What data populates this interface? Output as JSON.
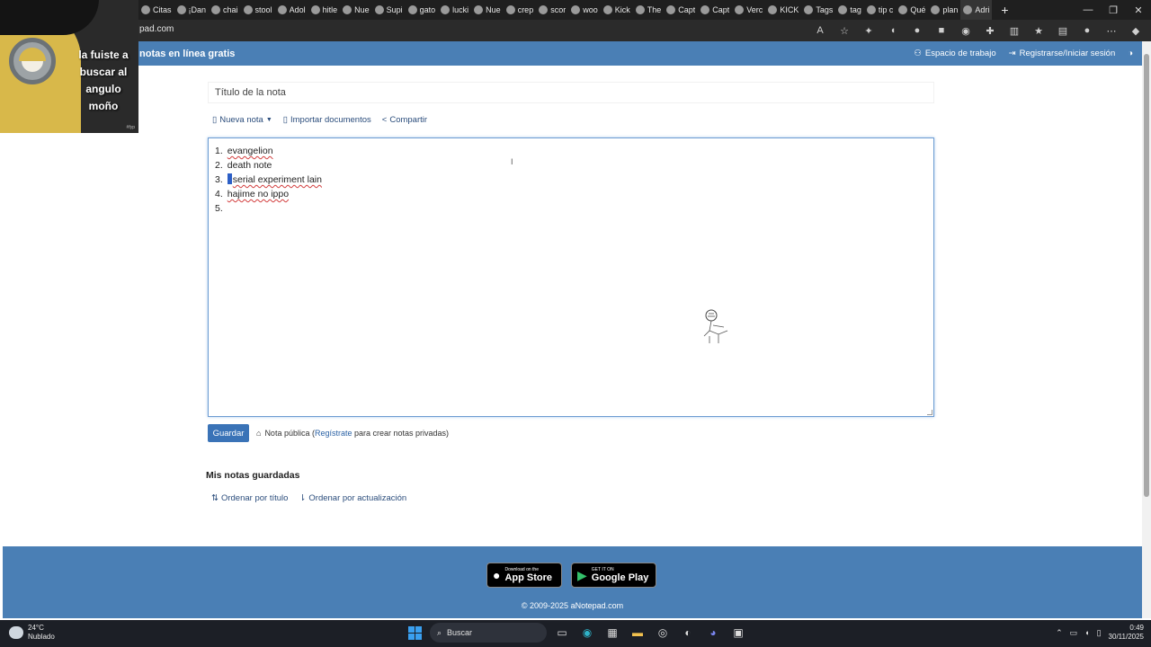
{
  "browser": {
    "tabs": [
      {
        "label": "Citas"
      },
      {
        "label": "¡Dan"
      },
      {
        "label": "chai"
      },
      {
        "label": "stool"
      },
      {
        "label": "Adol"
      },
      {
        "label": "hitle"
      },
      {
        "label": "Nue"
      },
      {
        "label": "Supi"
      },
      {
        "label": "gato"
      },
      {
        "label": "lucki"
      },
      {
        "label": "Nue"
      },
      {
        "label": "crep"
      },
      {
        "label": "scor"
      },
      {
        "label": "woo"
      },
      {
        "label": "Kick"
      },
      {
        "label": "The"
      },
      {
        "label": "Capt"
      },
      {
        "label": "Capt"
      },
      {
        "label": "Verc"
      },
      {
        "label": "KICK"
      },
      {
        "label": "Tags"
      },
      {
        "label": "tag"
      },
      {
        "label": "tip c"
      },
      {
        "label": "Qué"
      },
      {
        "label": "plan"
      },
      {
        "label": "Adri"
      }
    ],
    "new_tab": "+",
    "url": "pad.com",
    "window_controls": {
      "minimize": "—",
      "maximize": "❐",
      "close": "✕"
    }
  },
  "overlay": {
    "caption": "la fuiste a buscar al angulo moño",
    "credit": "#fyp"
  },
  "header": {
    "brand": "notas en línea gratis",
    "workspace": "Espacio de trabajo",
    "login": "Registrarse/Iniciar sesión"
  },
  "note": {
    "title_placeholder": "Título de la nota",
    "toolbar": {
      "new_note": "Nueva nota",
      "import_docs": "Importar documentos",
      "share": "Compartir"
    },
    "lines": [
      {
        "num": "1.",
        "text": "evangelion"
      },
      {
        "num": "2.",
        "text": "death note"
      },
      {
        "num": "3.",
        "text": "serial experiment lain"
      },
      {
        "num": "4.",
        "text": "hajime no ippo"
      },
      {
        "num": "5.",
        "text": ""
      }
    ]
  },
  "actions": {
    "save": "Guardar",
    "public_note": "Nota pública (",
    "register": "Regístrate",
    "private_hint": " para crear notas privadas)"
  },
  "saved": {
    "title": "Mis notas guardadas",
    "sort_title": "Ordenar por título",
    "sort_update": "Ordenar por actualización"
  },
  "footer": {
    "appstore_small": "Download on the",
    "appstore_big": "App Store",
    "play_small": "GET IT ON",
    "play_big": "Google Play",
    "copyright": "© 2009-2025 aNotepad.com"
  },
  "taskbar": {
    "temperature": "24°C",
    "weather": "Nublado",
    "search": "Buscar",
    "time": "0:49",
    "date": "30/11/2025"
  }
}
